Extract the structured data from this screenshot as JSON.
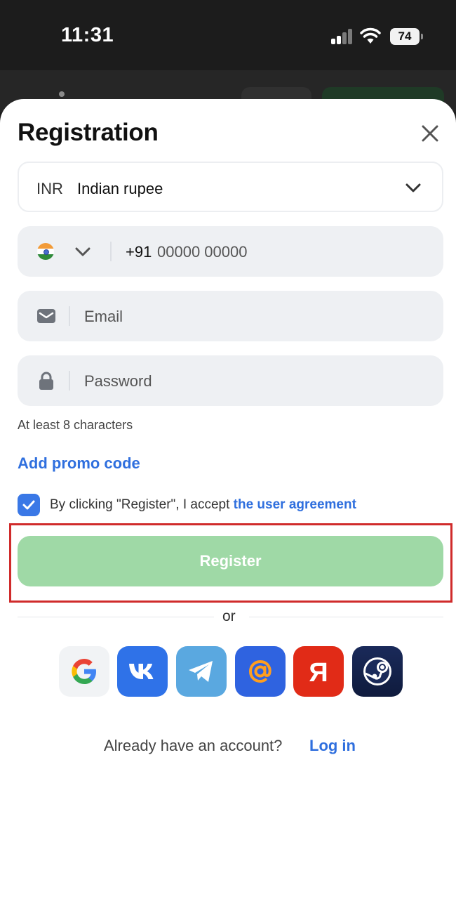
{
  "status_bar": {
    "time": "11:31",
    "battery": "74"
  },
  "form": {
    "title": "Registration",
    "currency": {
      "code": "INR",
      "name": "Indian rupee"
    },
    "phone": {
      "prefix": "+91",
      "placeholder": "00000 00000"
    },
    "email": {
      "placeholder": "Email"
    },
    "password": {
      "placeholder": "Password",
      "hint": "At least 8 characters"
    },
    "promo_link": "Add promo code",
    "agreement": {
      "checked": true,
      "text": "By clicking \"Register\", I accept ",
      "link": "the user agreement"
    },
    "register_label": "Register",
    "divider_text": "or",
    "social": [
      "google-icon",
      "vk-icon",
      "telegram-icon",
      "mail-ru-icon",
      "yandex-icon",
      "steam-icon"
    ],
    "already_text": "Already have an account?",
    "login_link": "Log in"
  },
  "colors": {
    "accent": "#2f6fde",
    "register_button": "#9fd9a6",
    "highlight": "#d02b2b"
  }
}
